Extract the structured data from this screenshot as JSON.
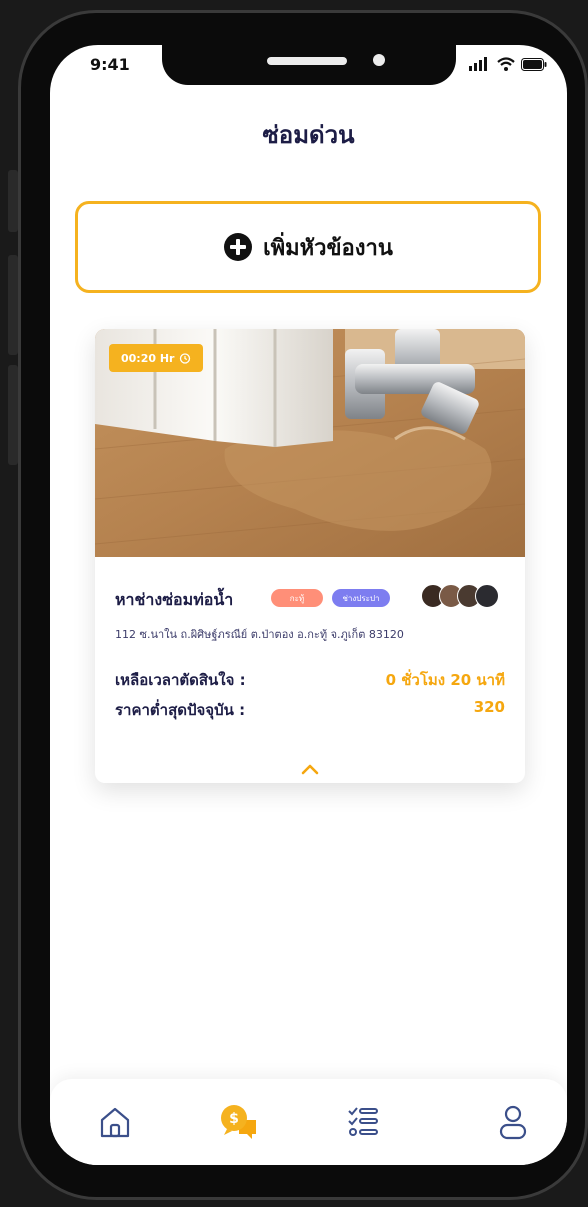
{
  "status_bar": {
    "time": "9:41"
  },
  "header": {
    "title": "ซ่อมด่วน"
  },
  "add_job": {
    "label": "เพิ่มหัวข้องาน",
    "icon": "plus-circle-icon"
  },
  "job_card": {
    "timer": "00:20 Hr",
    "title": "หาช่างซ่อมท่อน้ำ",
    "tags": [
      {
        "label": "กะทู้",
        "color": "#ff8f78"
      },
      {
        "label": "ช่างประปา",
        "color": "#7d7df0"
      }
    ],
    "address": "112 ซ.นาใน ถ.ผิศิษฐ์ภรณีย์ ต.ป่าตอง อ.กะทู้ จ.ภูเก็ต 83120",
    "time_left_label": "เหลือเวลาตัดสินใจ :",
    "time_left_value": "0 ชั่วโมง 20 นาที",
    "price_label": "ราคาต่ำสุดปัจจุบัน :",
    "price_value": "320"
  },
  "bottom_nav": {
    "items": [
      {
        "name": "home",
        "icon": "home-icon"
      },
      {
        "name": "chat",
        "icon": "chat-coin-icon",
        "active": true
      },
      {
        "name": "tasks",
        "icon": "checklist-icon"
      },
      {
        "name": "profile",
        "icon": "user-icon"
      }
    ]
  },
  "colors": {
    "accent": "#f5b21f",
    "title": "#1d1d46",
    "value": "#f5a70f",
    "inactive_icon": "#3b4f8a"
  }
}
